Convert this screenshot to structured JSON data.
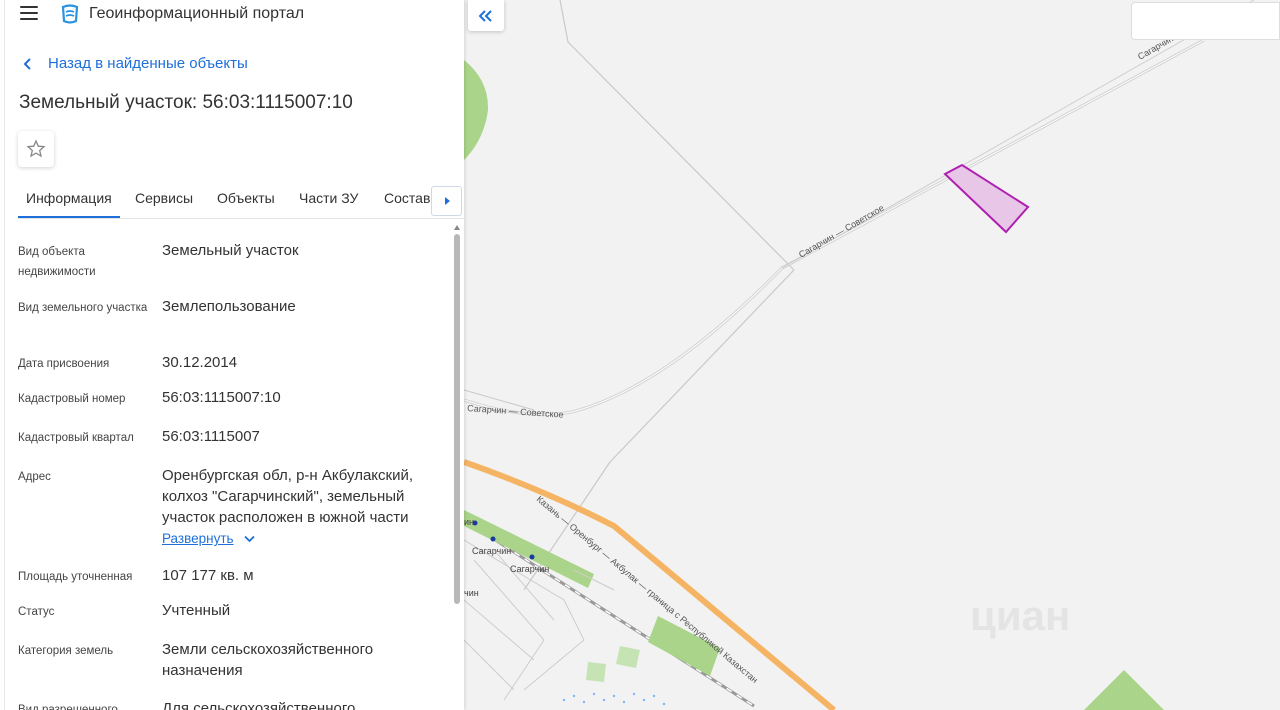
{
  "app": {
    "title": "Геоинформационный портал"
  },
  "nav": {
    "back_label": "Назад в найденные объекты"
  },
  "object": {
    "title": "Земельный участок: 56:03:1115007:10"
  },
  "tabs": [
    {
      "label": "Информация"
    },
    {
      "label": "Сервисы"
    },
    {
      "label": "Объекты"
    },
    {
      "label": "Части ЗУ"
    },
    {
      "label": "Состав"
    }
  ],
  "info": [
    {
      "label": "Вид объекта недвижимости",
      "value": "Земельный участок"
    },
    {
      "label": "Вид земельного участка",
      "value": "Землепользование"
    },
    {
      "label": "Дата присвоения",
      "value": "30.12.2014"
    },
    {
      "label": "Кадастровый номер",
      "value": "56:03:1115007:10"
    },
    {
      "label": "Кадастровый квартал",
      "value": "56:03:1115007"
    },
    {
      "label": "Адрес",
      "value": "Оренбургская обл, р-н Акбулакский, колхоз \"Сагарчинский\", земельный участок расположен в южной части"
    },
    {
      "label": "Площадь уточненная",
      "value": "107 177 кв. м"
    },
    {
      "label": "Статус",
      "value": "Учтенный"
    },
    {
      "label": "Категория земель",
      "value": "Земли сельскохозяйственного назначения"
    },
    {
      "label": "Вид разрешенного",
      "value": "Для сельскохозяйственного"
    }
  ],
  "expand_label": "Развернуть",
  "map": {
    "road_label_1": "Сагарчин — Советское",
    "road_label_2": "Сагарчин — Советское",
    "road_label_3": "Сагарчин",
    "highway_label": "Казань — Оренбург — Акбулак — граница с Республикой Казахстан",
    "town_1": "Сагарчин",
    "town_2": "Сагарчин",
    "town_3": "ин",
    "town_4": "чин",
    "watermark": "циан"
  },
  "colors": {
    "accent": "#1e6fd9",
    "parcel_stroke": "#b020b0",
    "parcel_fill": "#e8c6e8",
    "highway": "#f5b463",
    "green": "#a9d48a"
  }
}
